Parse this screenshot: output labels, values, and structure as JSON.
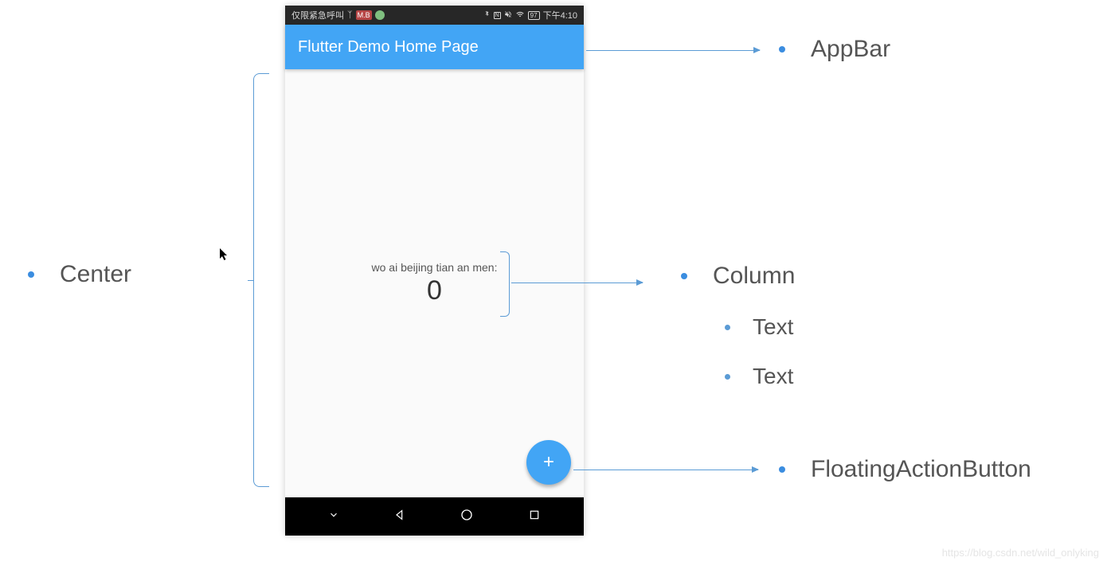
{
  "phone": {
    "status_bar": {
      "left_text": "仅限紧急呼叫",
      "right_text": "下午4:10",
      "battery": "97"
    },
    "appbar": {
      "title": "Flutter Demo Home Page"
    },
    "body": {
      "text1": "wo ai beijing tian an men:",
      "counter": "0"
    },
    "fab": {
      "icon": "+"
    }
  },
  "annotations": {
    "center": "Center",
    "appbar": "AppBar",
    "column": "Column",
    "text": "Text",
    "fab": "FloatingActionButton"
  },
  "watermark": "https://blog.csdn.net/wild_onlyking"
}
